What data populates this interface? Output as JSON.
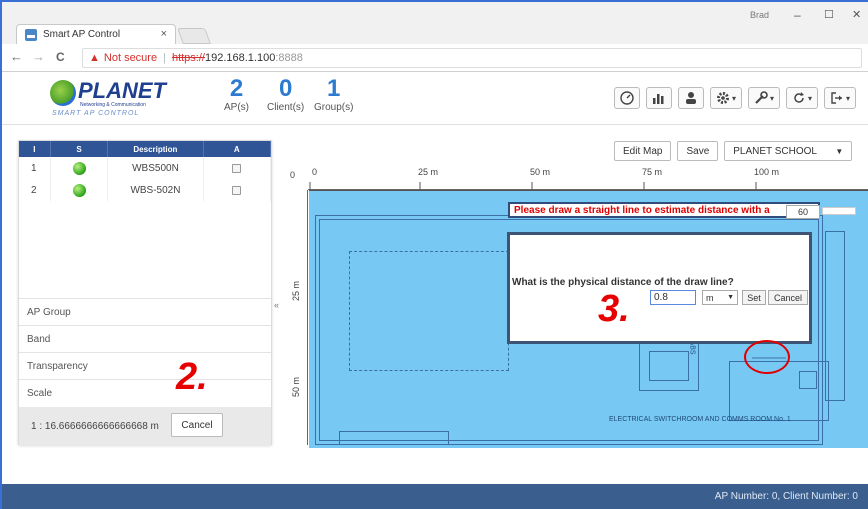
{
  "browser": {
    "tab_title": "Smart AP Control",
    "tab_close": "×",
    "user_label": "Brad",
    "window_controls": [
      "–",
      "☐",
      "✕"
    ],
    "nav": {
      "back": "←",
      "forward": "→",
      "reload": "C"
    },
    "security_label": "Not secure",
    "url_protocol": "https://",
    "url_host": "192.168.1.100",
    "url_port": ":8888"
  },
  "header": {
    "logo_word": "PLANET",
    "logo_tagline": "Networking & Communication",
    "logo_sub": "SMART AP CONTROL",
    "stats": [
      {
        "value": "2",
        "label": "AP(s)"
      },
      {
        "value": "0",
        "label": "Client(s)"
      },
      {
        "value": "1",
        "label": "Group(s)"
      }
    ],
    "toolbar_icons": [
      "dashboard-icon",
      "chart-icon",
      "users-icon",
      "gear-icon",
      "wrench-icon",
      "refresh-icon",
      "logout-icon"
    ]
  },
  "ap_table": {
    "columns": [
      "I",
      "S",
      "Description",
      "A"
    ],
    "rows": [
      {
        "index": "1",
        "description": "WBS500N"
      },
      {
        "index": "2",
        "description": "WBS-502N"
      }
    ]
  },
  "panel": {
    "sections": [
      "AP Group",
      "Band",
      "Transparency",
      "Scale"
    ],
    "scale_value": "1 : 16.6666666666666668 m",
    "cancel_label": "Cancel",
    "collapse_glyph": "«"
  },
  "steps": {
    "step2": "2.",
    "step3": "3."
  },
  "map_toolbar": {
    "edit_map": "Edit Map",
    "save": "Save",
    "location": "PLANET SCHOOL"
  },
  "ruler": {
    "origin": "0",
    "h_ticks": [
      "0",
      "25 m",
      "50 m",
      "75 m",
      "100 m"
    ],
    "v_ticks": [
      "25 m",
      "50 m"
    ]
  },
  "overlay": {
    "instruction": "Please draw a straight line to estimate distance with a",
    "line_length": "60",
    "question": "What is the physical distance of the draw line?",
    "distance_value": "0.8",
    "unit": "m",
    "set_label": "Set",
    "cancel_label": "Cancel"
  },
  "floorplan": {
    "room_label": "ELECTRICAL SWITCHROOM AND COMMS ROOM No. 1",
    "cabs_label": "CT CABS"
  },
  "footer": {
    "status": "AP Number: 0, Client Number: 0"
  }
}
